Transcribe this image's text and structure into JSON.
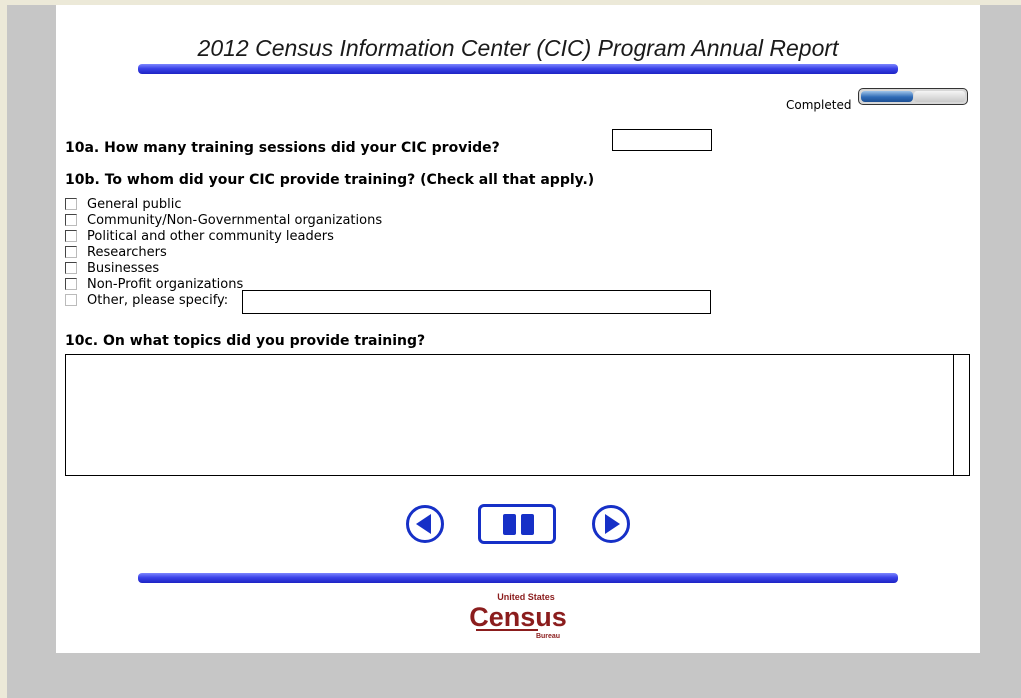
{
  "header": {
    "title": "2012 Census Information Center (CIC) Program Annual Report"
  },
  "progress": {
    "label": "Completed",
    "fraction": 0.5
  },
  "q10a": {
    "question": "10a. How many training sessions did your CIC provide?",
    "value": ""
  },
  "q10b": {
    "question": "10b. To whom did your CIC provide training? (Check all that apply.)",
    "options": [
      "General public",
      "Community/Non-Governmental organizations",
      "Political and other community leaders",
      "Researchers",
      "Businesses",
      "Non-Profit organizations",
      "Other, please specify:"
    ],
    "other_value": ""
  },
  "q10c": {
    "question": "10c. On what topics did you provide training?",
    "value": ""
  },
  "logo": {
    "line1": "United States",
    "line2": "Census",
    "line3": "Bureau"
  },
  "colors": {
    "accent": "#1630c7",
    "bar": "#3b43e8",
    "progress_fill": "#2f6bb6"
  },
  "icons": {
    "prev": "previous-arrow-icon",
    "pause": "pause-icon",
    "next": "next-arrow-icon"
  }
}
